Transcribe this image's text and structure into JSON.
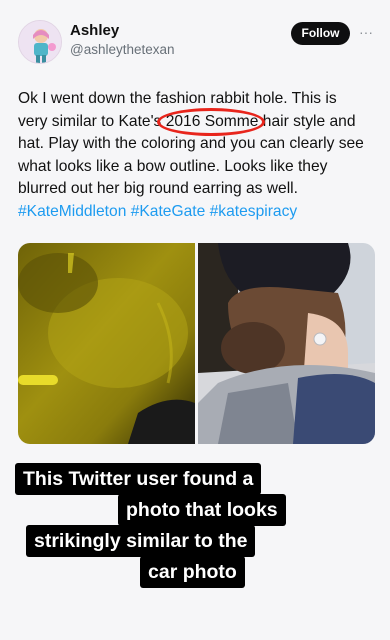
{
  "post": {
    "author_name": "Ashley",
    "author_handle": "@ashleythetexan",
    "follow_label": "Follow",
    "more_label": "···",
    "text_main": "Ok I went down the fashion rabbit hole. This is very similar to Kate's 2016 Somme hair style and hat. Play with the coloring and you can clearly see what looks like a bow outline. Looks like they blurred out her big round earring as well. ",
    "hashtags": [
      "#KateMiddleton",
      "#KateGate",
      "#katespiracy"
    ]
  },
  "media": {
    "left_icon": "blurred-yellow-car-photo",
    "right_icon": "woman-hair-bun-hat-photo"
  },
  "caption": {
    "lines": [
      "This Twitter user found a",
      "photo that looks",
      "strikingly similar to the",
      "car photo"
    ]
  },
  "colors": {
    "accent_link": "#1d9bf0",
    "circle": "#e8251c",
    "follow_bg": "#0f0f10"
  }
}
